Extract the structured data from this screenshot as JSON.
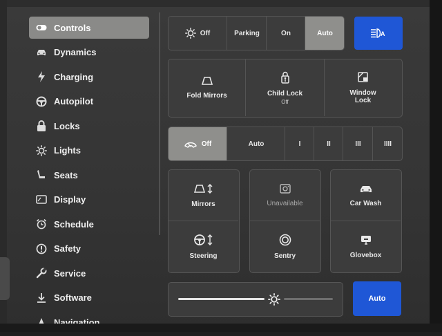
{
  "sidebar": {
    "items": [
      {
        "label": "Controls",
        "icon": "toggle-icon",
        "active": true
      },
      {
        "label": "Dynamics",
        "icon": "car-icon"
      },
      {
        "label": "Charging",
        "icon": "lightning-icon"
      },
      {
        "label": "Autopilot",
        "icon": "steering-wheel-icon"
      },
      {
        "label": "Locks",
        "icon": "lock-icon"
      },
      {
        "label": "Lights",
        "icon": "sun-icon"
      },
      {
        "label": "Seats",
        "icon": "seat-icon"
      },
      {
        "label": "Display",
        "icon": "display-icon"
      },
      {
        "label": "Schedule",
        "icon": "alarm-clock-icon"
      },
      {
        "label": "Safety",
        "icon": "alert-circle-icon"
      },
      {
        "label": "Service",
        "icon": "wrench-icon"
      },
      {
        "label": "Software",
        "icon": "download-icon"
      },
      {
        "label": "Navigation",
        "icon": "navigation-arrow-icon"
      }
    ]
  },
  "lights": {
    "options": [
      "Off",
      "Parking",
      "On",
      "Auto"
    ],
    "selected": "Auto",
    "auto_high_beam_icon": "auto-high-beam-icon"
  },
  "toggles": [
    {
      "label": "Fold Mirrors",
      "sub": "",
      "icon": "mirror-icon"
    },
    {
      "label": "Child Lock",
      "sub": "Off",
      "icon": "child-lock-icon"
    },
    {
      "label": "Window",
      "label2": "Lock",
      "icon": "window-lock-icon"
    }
  ],
  "wipers": {
    "options": [
      "Off",
      "Auto",
      "I",
      "II",
      "III",
      "IIII"
    ],
    "selected": "Off"
  },
  "grid": [
    {
      "label": "Mirrors",
      "icon": "mirror-adjust-icon"
    },
    {
      "label": "Unavailable",
      "icon": "camera-icon"
    },
    {
      "label": "Car Wash",
      "icon": "car-wash-icon"
    },
    {
      "label": "Steering",
      "icon": "steering-adjust-icon"
    },
    {
      "label": "Sentry",
      "icon": "sentry-icon"
    },
    {
      "label": "Glovebox",
      "icon": "glovebox-icon"
    }
  ],
  "brightness": {
    "level": 0.62,
    "auto_label": "Auto",
    "icon": "brightness-sun-icon"
  },
  "colors": {
    "accent": "#1f57d6",
    "active_segment": "#8f8f8c",
    "background": "#3a3a3a"
  }
}
